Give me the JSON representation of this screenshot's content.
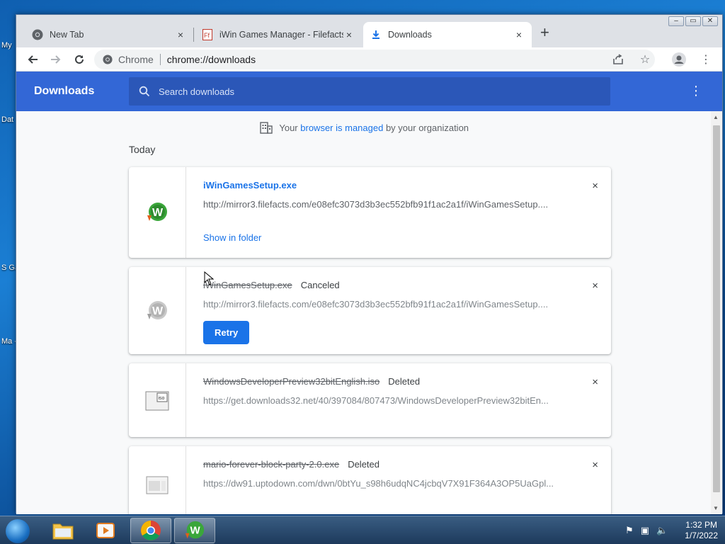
{
  "desktop": {
    "icons": [
      "My",
      "Dat",
      "S Gar",
      "Ma - B"
    ]
  },
  "browser": {
    "tabs": [
      {
        "title": "New Tab",
        "close": "×"
      },
      {
        "title": "iWin Games Manager - Filefacts",
        "close": "×"
      },
      {
        "title": "Downloads",
        "close": "×"
      }
    ],
    "new_tab": "+",
    "omnibox": {
      "chip": "Chrome",
      "url": "chrome://downloads"
    }
  },
  "downloads": {
    "title": "Downloads",
    "search_placeholder": "Search downloads",
    "managed": {
      "prefix": "Your",
      "link": "browser is managed",
      "suffix": "by your organization"
    },
    "section": "Today",
    "items": [
      {
        "name": "iWinGamesSetup.exe",
        "status": "",
        "url": "http://mirror3.filefacts.com/e08efc3073d3b3ec552bfb91f1ac2a1f/iWinGamesSetup....",
        "action": "Show in folder"
      },
      {
        "name": "iWinGamesSetup.exe",
        "status": "Canceled",
        "url": "http://mirror3.filefacts.com/e08efc3073d3b3ec552bfb91f1ac2a1f/iWinGamesSetup....",
        "action": "Retry"
      },
      {
        "name": "WindowsDeveloperPreview32bitEnglish.iso",
        "status": "Deleted",
        "url": "https://get.downloads32.net/40/397084/807473/WindowsDeveloperPreview32bitEn..."
      },
      {
        "name": "mario-forever-block-party-2.0.exe",
        "status": "Deleted",
        "url": "https://dw91.uptodown.com/dwn/0btYu_s98h6udqNC4jcbqV7X91F364A3OP5UaGpl..."
      }
    ],
    "close": "×"
  },
  "taskbar": {
    "time": "1:32 PM",
    "date": "1/7/2022"
  }
}
